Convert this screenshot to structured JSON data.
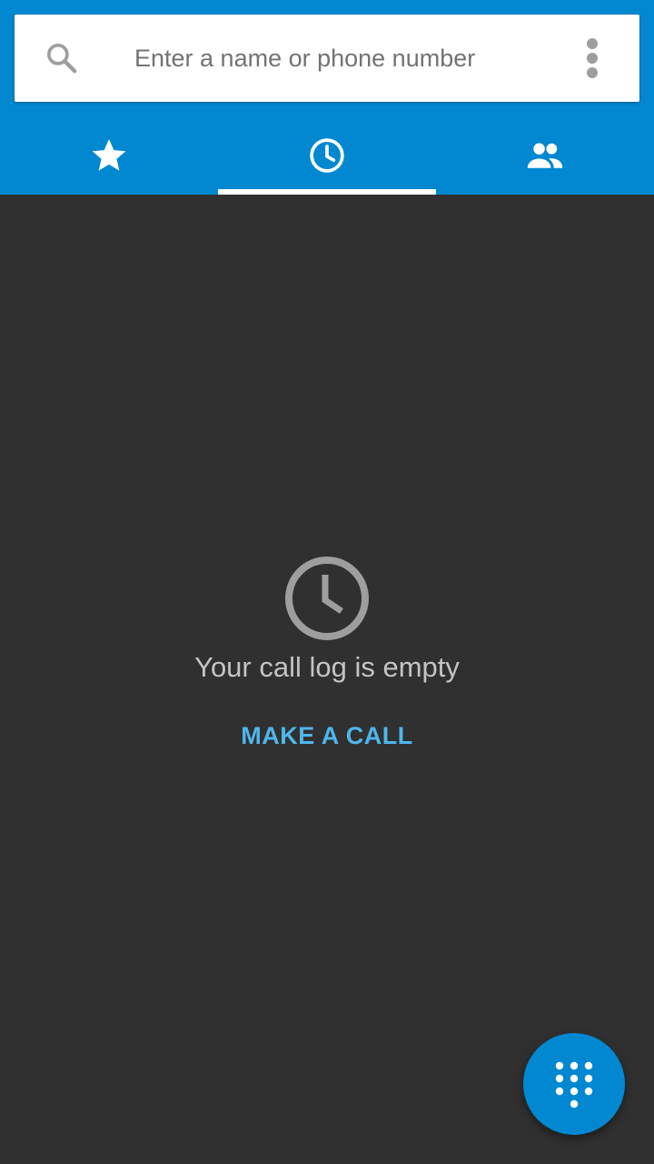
{
  "search": {
    "placeholder": "Enter a name or phone number",
    "icon": "search-icon",
    "menu_icon": "more-vert-icon"
  },
  "tabs": [
    {
      "icon": "star-icon",
      "name": "favorites",
      "selected": false
    },
    {
      "icon": "clock-icon",
      "name": "recents",
      "selected": true
    },
    {
      "icon": "people-icon",
      "name": "contacts",
      "selected": false
    }
  ],
  "empty_state": {
    "icon": "clock-icon",
    "message": "Your call log is empty",
    "action_label": "MAKE A CALL"
  },
  "fab": {
    "icon": "dialpad-icon"
  },
  "colors": {
    "primary": "#0288d1",
    "background": "#303030",
    "accent_text": "#4fb6ec",
    "muted_text": "#c4c4c4",
    "empty_icon": "#9e9e9e"
  }
}
